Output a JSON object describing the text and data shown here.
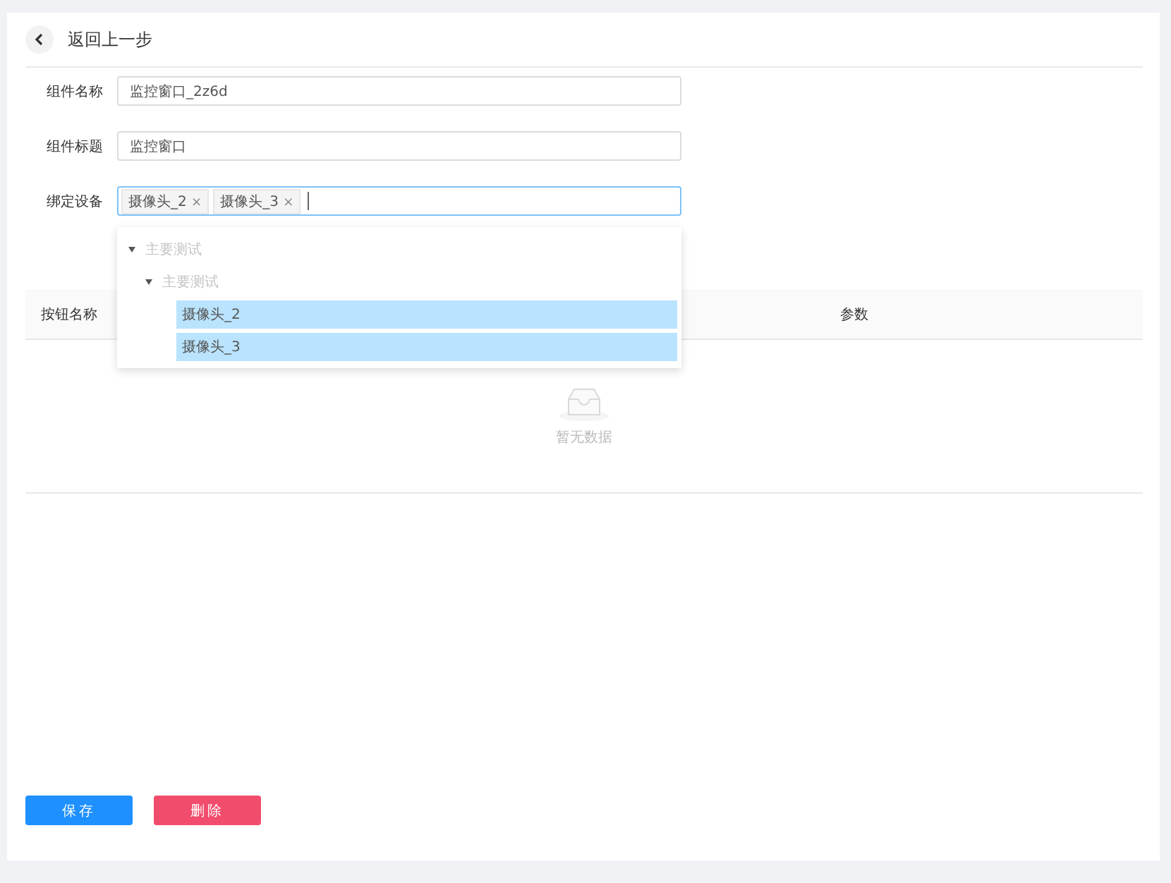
{
  "header": {
    "back_label": "返回上一步"
  },
  "form": {
    "fields": [
      {
        "label": "组件名称",
        "kind": "text",
        "value": "监控窗口_2z6d"
      },
      {
        "label": "组件标题",
        "kind": "text",
        "value": "监控窗口"
      },
      {
        "label": "绑定设备",
        "kind": "tags",
        "focused": true,
        "tags": [
          {
            "label": "摄像头_2",
            "remove": "×"
          },
          {
            "label": "摄像头_3",
            "remove": "×"
          }
        ]
      }
    ]
  },
  "dropdown": {
    "tree": [
      {
        "label": "主要测试",
        "expanded": true,
        "disabled": true,
        "children": [
          {
            "label": "主要测试",
            "expanded": true,
            "disabled": true,
            "children": [
              {
                "label": "摄像头_2",
                "selected": true
              },
              {
                "label": "摄像头_3",
                "selected": true
              }
            ]
          }
        ]
      }
    ]
  },
  "table": {
    "columns": [
      "按钮名称",
      "参数"
    ],
    "empty_text": "暂无数据"
  },
  "buttons": [
    {
      "label": "保存",
      "kind": "primary"
    },
    {
      "label": "删除",
      "kind": "danger"
    }
  ]
}
